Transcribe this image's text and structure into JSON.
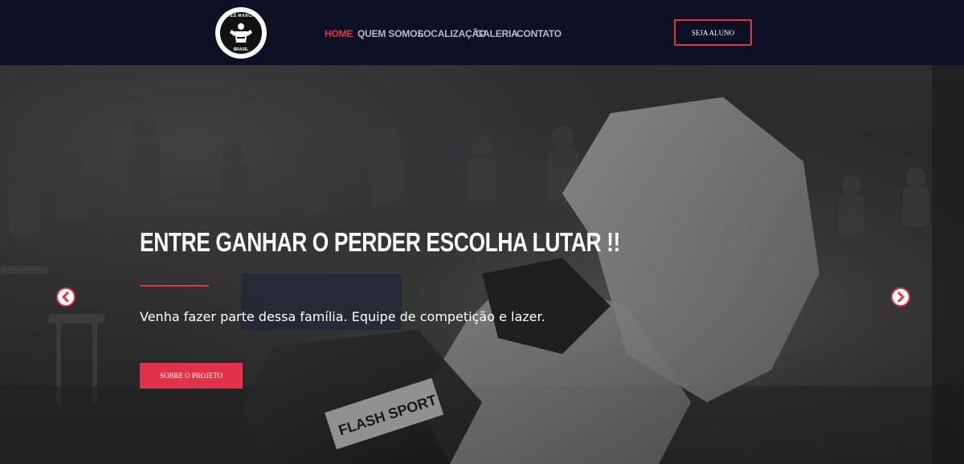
{
  "header": {
    "logo": {
      "top_text": "ARTES MARCIAIS",
      "bottom_text": "BRASIL"
    },
    "nav": [
      {
        "label": "HOME",
        "active": true
      },
      {
        "label": "QUEM SOMOS",
        "active": false
      },
      {
        "label": "LOCALIZAÇÃO",
        "active": false
      },
      {
        "label": "GALERIA",
        "active": false
      },
      {
        "label": "CONTATO",
        "active": false
      }
    ],
    "cta_label": "SEJA ALUNO"
  },
  "hero": {
    "headline": "ENTRE GANHAR O PERDER ESCOLHA LUTAR !!",
    "subtext": "Venha fazer parte dessa família. Equipe de competição e lazer.",
    "button_label": "SOBRE O PROJETO",
    "image_text": "FLASH SPORT"
  },
  "colors": {
    "accent": "#e1334a",
    "header_bg": "#0c1022",
    "nav_text": "#b8b9c4"
  },
  "icons": {
    "prev": "chevron-left-icon",
    "next": "chevron-right-icon"
  }
}
